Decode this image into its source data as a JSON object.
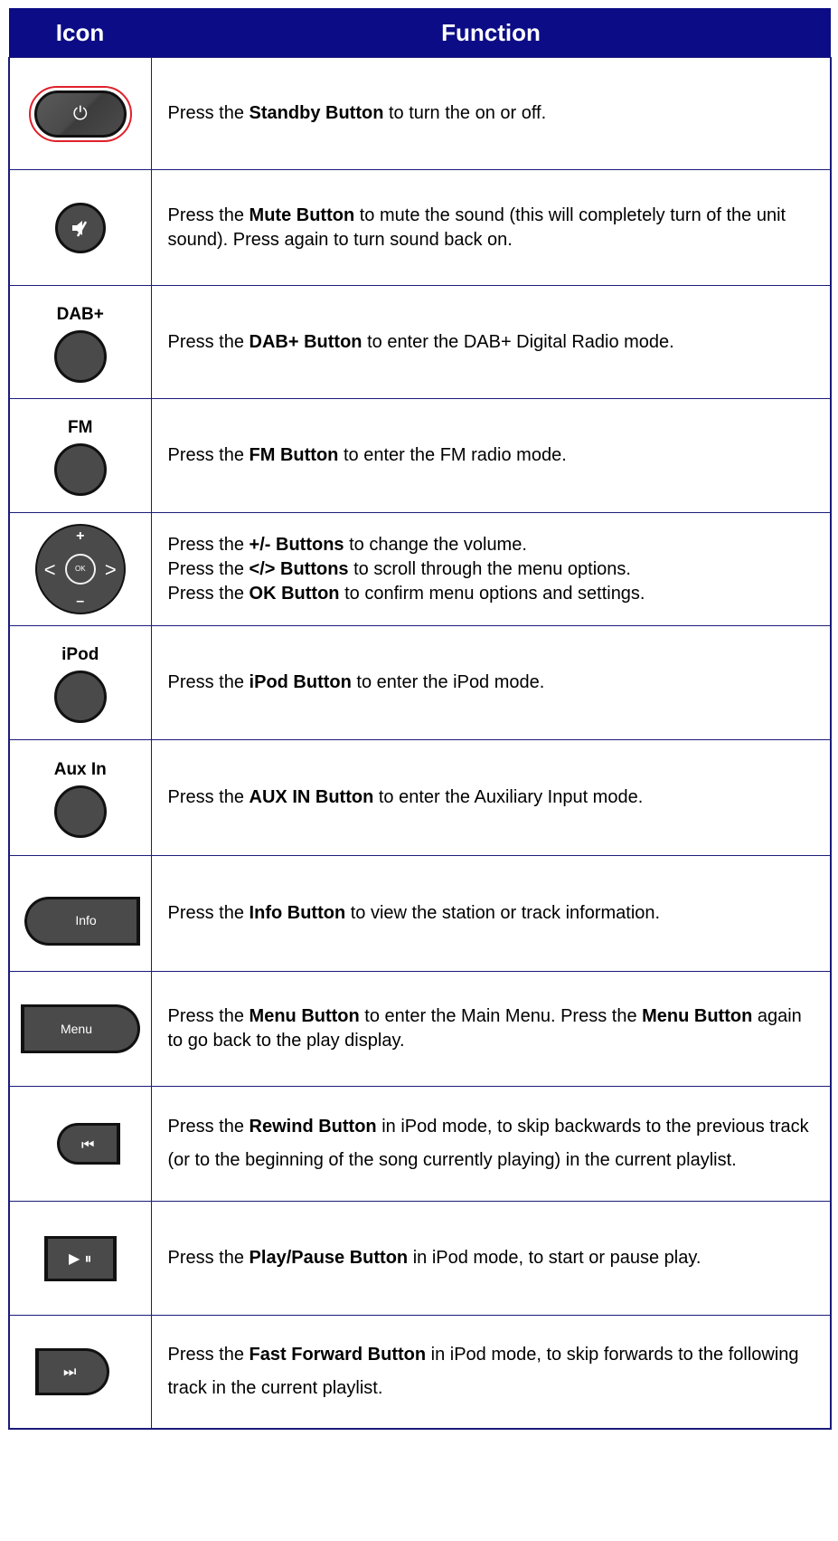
{
  "header": {
    "icon_col": "Icon",
    "function_col": "Function"
  },
  "rows": [
    {
      "glyph": "⏻",
      "parts": [
        "Press the ",
        "Standby Button",
        " to turn the on or off."
      ]
    },
    {
      "glyph": "mute",
      "parts": [
        "Press the ",
        "Mute Button",
        " to mute the sound (this will completely turn of the unit sound). Press again to turn sound back on."
      ]
    },
    {
      "label": "DAB+",
      "parts": [
        "Press the ",
        "DAB+ Button",
        " to enter the DAB+ Digital Radio mode."
      ]
    },
    {
      "label": "FM",
      "parts": [
        "Press the ",
        "FM Button",
        " to enter the FM radio mode."
      ]
    },
    {
      "dpad": {
        "plus": "+",
        "minus": "–",
        "left": "<",
        "right": ">",
        "ok": "OK"
      },
      "lines": [
        [
          "Press the ",
          "+/- Buttons",
          " to change the volume."
        ],
        [
          "Press the ",
          "</> Buttons",
          " to scroll through the menu options."
        ],
        [
          "Press the ",
          "OK Button",
          " to confirm menu options and settings."
        ]
      ]
    },
    {
      "label": "iPod",
      "parts": [
        "Press the ",
        "iPod Button",
        " to enter the iPod mode."
      ]
    },
    {
      "label": "Aux In",
      "parts": [
        "Press the ",
        "AUX IN Button",
        " to enter the Auxiliary Input mode."
      ]
    },
    {
      "button_text": "Info",
      "parts": [
        "Press the ",
        "Info Button",
        " to view the station or track information."
      ]
    },
    {
      "button_text": "Menu",
      "parts": [
        "Press the ",
        "Menu Button",
        " to enter the Main Menu. Press the ",
        "Menu Button",
        " again to go back to the play display."
      ]
    },
    {
      "glyph": "⏮",
      "parts": [
        "Press the ",
        "Rewind Button",
        " in iPod mode, to skip backwards to the previous track (or to the beginning of the song currently playing) in the current playlist."
      ]
    },
    {
      "glyph": "▶ ⏸",
      "parts": [
        "Press the ",
        "Play/Pause Button",
        " in iPod mode, to start or pause play."
      ]
    },
    {
      "glyph": "⏭",
      "parts": [
        "Press the ",
        "Fast Forward Button",
        " in iPod mode, to skip forwards to the following track in the current playlist."
      ]
    }
  ]
}
